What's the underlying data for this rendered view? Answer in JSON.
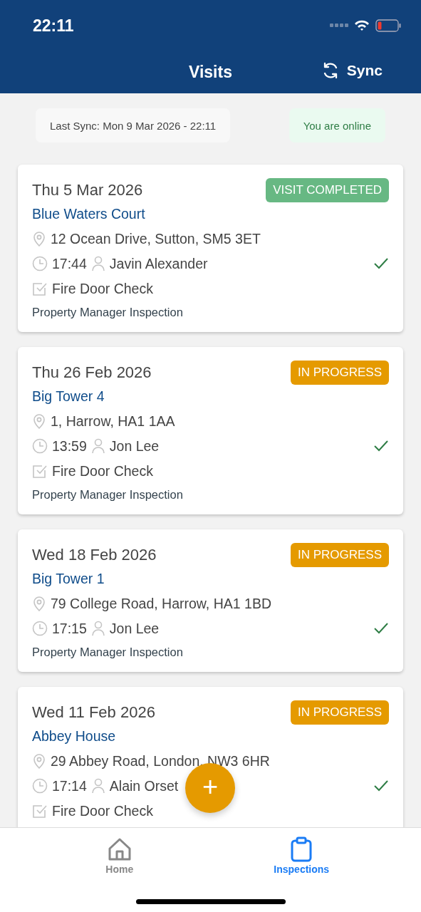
{
  "status_bar": {
    "time": "22:11"
  },
  "header": {
    "title": "Visits",
    "sync_button": "Sync"
  },
  "sync_info": {
    "last_sync": "Last Sync: Mon 9 Mar 2026 - 22:11",
    "connection": "You are online"
  },
  "visits": [
    {
      "date": "Thu 5 Mar 2026",
      "status": {
        "kind": "completed",
        "label": "VISIT COMPLETED"
      },
      "site": "Blue Waters Court",
      "address": "12 Ocean Drive, Sutton, SM5 3ET",
      "time": "17:44",
      "inspector": "Javin Alexander",
      "checked": true,
      "task": "Fire Door Check",
      "type": "Property Manager Inspection"
    },
    {
      "date": "Thu 26 Feb 2026",
      "status": {
        "kind": "in_progress",
        "label": "IN PROGRESS"
      },
      "site": "Big Tower 4",
      "address": "1, Harrow, HA1 1AA",
      "time": "13:59",
      "inspector": "Jon Lee",
      "checked": true,
      "task": "Fire Door Check",
      "type": "Property Manager Inspection"
    },
    {
      "date": "Wed 18 Feb 2026",
      "status": {
        "kind": "in_progress",
        "label": "IN PROGRESS"
      },
      "site": "Big Tower 1",
      "address": "79 College Road, Harrow, HA1 1BD",
      "time": "17:15",
      "inspector": "Jon Lee",
      "checked": true,
      "type": "Property Manager Inspection"
    },
    {
      "date": "Wed 11 Feb 2026",
      "status": {
        "kind": "in_progress",
        "label": "IN PROGRESS"
      },
      "site": "Abbey House",
      "address": "29 Abbey Road, London, NW3 6HR",
      "time": "17:14",
      "inspector": "Alain Orset",
      "checked": true,
      "task": "Fire Door Check"
    }
  ],
  "add_button": "+",
  "tab_bar": [
    {
      "kind": "home",
      "label": "Home",
      "selected": false
    },
    {
      "kind": "inspections",
      "label": "Inspections",
      "selected": true
    }
  ]
}
